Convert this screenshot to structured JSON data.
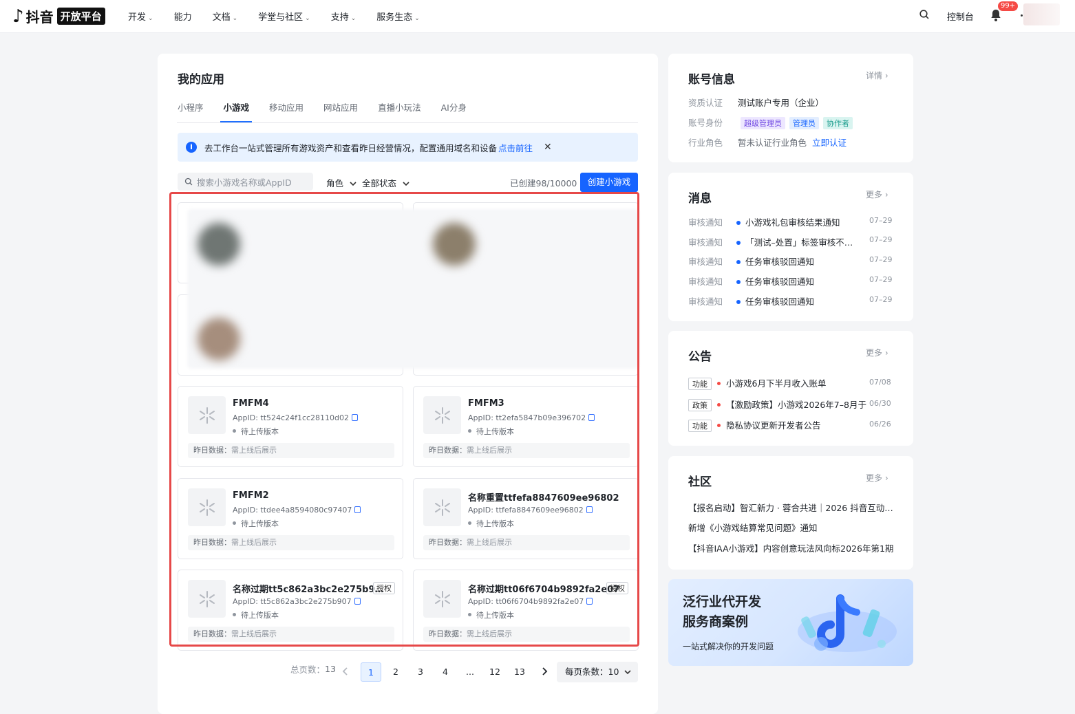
{
  "header": {
    "logo_note": "♪",
    "logo_brand": "抖音",
    "logo_platform": "开放平台",
    "nav": [
      {
        "label": "开发",
        "chev": "⌄"
      },
      {
        "label": "能力",
        "chev": ""
      },
      {
        "label": "文档",
        "chev": "⌄"
      },
      {
        "label": "学堂与社区",
        "chev": "⌄"
      },
      {
        "label": "支持",
        "chev": "⌄"
      },
      {
        "label": "服务生态",
        "chev": "⌄"
      }
    ],
    "console": "控制台",
    "badge": "99+"
  },
  "main": {
    "title": "我的应用",
    "tabs": [
      "小程序",
      "小游戏",
      "移动应用",
      "网站应用",
      "直播小玩法",
      "AI分身"
    ],
    "active_tab": 1,
    "banner_text": "去工作台一站式管理所有游戏资产和查看昨日经营情况，配置通用域名和设备",
    "banner_link": "点击前往",
    "banner_close": "✕",
    "search_placeholder": "搜索小游戏名称或AppID",
    "filter_role": "角色",
    "filter_status": "全部状态",
    "created_count": "已创建98/10000",
    "create_button": "创建小游戏",
    "yesterday_label": "昨日数据：",
    "yesterday_value": "需上线后展示",
    "cards": [
      {
        "name": "FMFM4",
        "appid": "AppID: tt524c24f1cc28110d02",
        "status": "待上传版本",
        "tag": ""
      },
      {
        "name": "FMFM3",
        "appid": "AppID: tt2efa5847b09e396702",
        "status": "待上传版本",
        "tag": ""
      },
      {
        "name": "FMFM2",
        "appid": "AppID: ttdee4a8594080c97407",
        "status": "待上传版本",
        "tag": ""
      },
      {
        "name": "名称重置ttfefa8847609ee96802",
        "appid": "AppID: ttfefa8847609ee96802",
        "status": "待上传版本",
        "tag": ""
      },
      {
        "name": "名称过期tt5c862a3bc2e275b9…",
        "appid": "AppID: tt5c862a3bc2e275b907",
        "status": "待上传版本",
        "tag": "授权"
      },
      {
        "name": "名称过期tt06f6704b9892fa2e07",
        "appid": "AppID: tt06f6704b9892fa2e07",
        "status": "待上传版本",
        "tag": "授权"
      }
    ],
    "pagination": {
      "total_label": "总页数：",
      "total": "13",
      "pages": [
        "1",
        "2",
        "3",
        "4",
        "...",
        "12",
        "13"
      ],
      "current": "1",
      "per_page_label": "每页条数：",
      "per_page": "10"
    }
  },
  "account": {
    "title": "账号信息",
    "more": "详情 ›",
    "qual_label": "资质认证",
    "qual_value": "测试账户专用（企业）",
    "role_label": "账号身份",
    "roles": [
      "超级管理员",
      "管理员",
      "协作者"
    ],
    "industry_label": "行业角色",
    "industry_value": "暂未认证行业角色",
    "industry_link": "立即认证"
  },
  "messages": {
    "title": "消息",
    "more": "更多 ›",
    "items": [
      {
        "type": "审核通知",
        "text": "小游戏礼包审核结果通知",
        "date": "07–29"
      },
      {
        "type": "审核通知",
        "text": "「测试–处置」标签审核不…",
        "date": "07–29"
      },
      {
        "type": "审核通知",
        "text": "任务审核驳回通知",
        "date": "07–29"
      },
      {
        "type": "审核通知",
        "text": "任务审核驳回通知",
        "date": "07–29"
      },
      {
        "type": "审核通知",
        "text": "任务审核驳回通知",
        "date": "07–29"
      }
    ]
  },
  "notices": {
    "title": "公告",
    "more": "更多 ›",
    "items": [
      {
        "tag": "功能",
        "text": "小游戏6月下半月收入账单",
        "date": "07/08"
      },
      {
        "tag": "政策",
        "text": "【激励政策】小游戏2026年7–8月于",
        "date": "06/30"
      },
      {
        "tag": "功能",
        "text": "隐私协议更新开发者公告",
        "date": "06/26"
      }
    ]
  },
  "community": {
    "title": "社区",
    "more": "更多 ›",
    "items": [
      "【报名启动】智汇新力 · 蓉合共进｜2026 抖音互动…",
      "新增《小游戏结算常见问题》通知",
      "【抖音IAA小游戏】内容创意玩法风向标2026年第1期"
    ]
  },
  "promo": {
    "line1": "泛行业代开发",
    "line2": "服务商案例",
    "line3": "一站式解决你的开发问题"
  },
  "colors": {
    "accent": "#1664ff",
    "highlight": "#e64848"
  }
}
